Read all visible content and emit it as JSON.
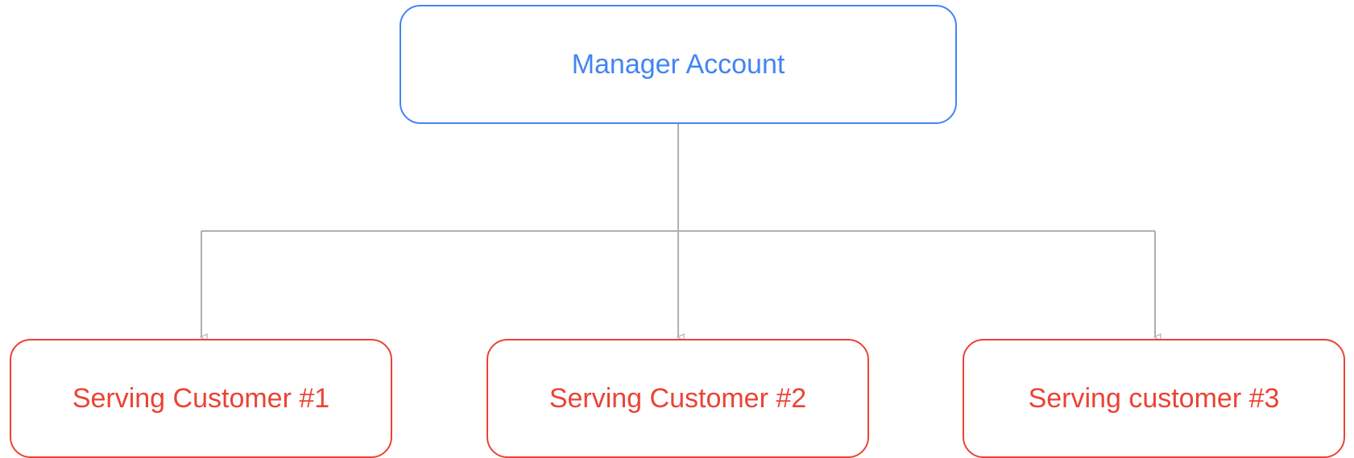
{
  "diagram": {
    "root": {
      "label": "Manager Account"
    },
    "children": [
      {
        "label": "Serving Customer #1"
      },
      {
        "label": "Serving Customer #2"
      },
      {
        "label": "Serving customer #3"
      }
    ]
  },
  "colors": {
    "root_accent": "#4285f4",
    "child_accent": "#ea4335",
    "connector": "#b0b0b0"
  }
}
